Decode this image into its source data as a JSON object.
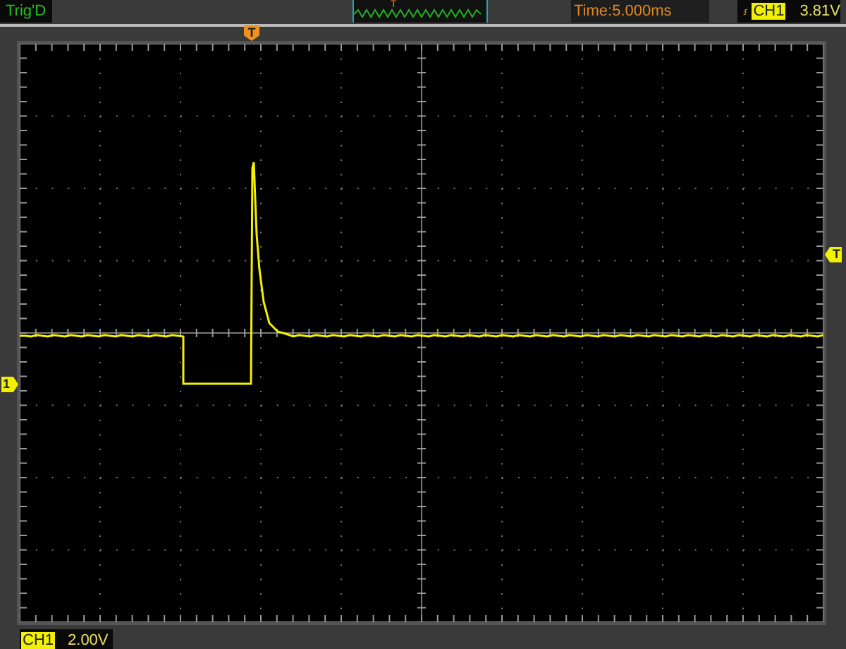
{
  "status": {
    "trigger_state": "Trig'D"
  },
  "overview": {
    "trigger_mark": "T"
  },
  "timebase": "Time:5.000ms",
  "trigger": {
    "source": "CH1",
    "level": "3.81V"
  },
  "markers": {
    "trigger_position": "T",
    "trigger_level": "T",
    "channel": "1"
  },
  "channel": {
    "name": "CH1",
    "scale": "2.00V"
  }
}
